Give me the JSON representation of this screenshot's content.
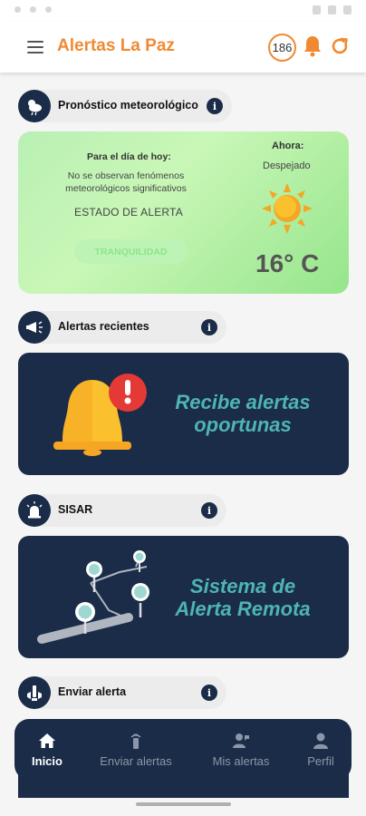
{
  "app": {
    "title": "Alertas La Paz",
    "notification_count": "186",
    "accent_color": "#f08a32",
    "dark_color": "#1a2c47"
  },
  "header_icons": [
    "menu-icon",
    "bell-icon",
    "refresh-icon"
  ],
  "sections": {
    "weather": {
      "label": "Pronóstico meteorológico",
      "icon": "weather-icon"
    },
    "recent": {
      "label": "Alertas recientes",
      "icon": "megaphone-icon"
    },
    "sisar": {
      "label": "SISAR",
      "icon": "siren-icon"
    },
    "send": {
      "label": "Enviar alerta",
      "icon": "send-alert-icon"
    }
  },
  "weather_card": {
    "today_label": "Para el día de hoy:",
    "description": "No se observan fenómenos meteorológicos significativos",
    "state_label": "ESTADO DE ALERTA",
    "state_value": "TRANQUILIDAD",
    "now_label": "Ahora:",
    "condition": "Despejado",
    "temperature": "16° C",
    "icon": "sun-icon"
  },
  "banners": {
    "recent": {
      "text_line1": "Recibe alertas",
      "text_line2": "oportunas",
      "icon": "alert-bell-icon"
    },
    "sisar": {
      "text_line1": "Sistema de",
      "text_line2": "Alerta Remota",
      "icon": "remote-sensors-icon"
    }
  },
  "bottom_nav": {
    "items": [
      {
        "label": "Inicio",
        "icon": "home-icon",
        "active": true
      },
      {
        "label": "Enviar alertas",
        "icon": "transmitter-icon",
        "active": false
      },
      {
        "label": "Mis alertas",
        "icon": "user-alerts-icon",
        "active": false
      },
      {
        "label": "Perfil",
        "icon": "person-icon",
        "active": false
      }
    ]
  }
}
